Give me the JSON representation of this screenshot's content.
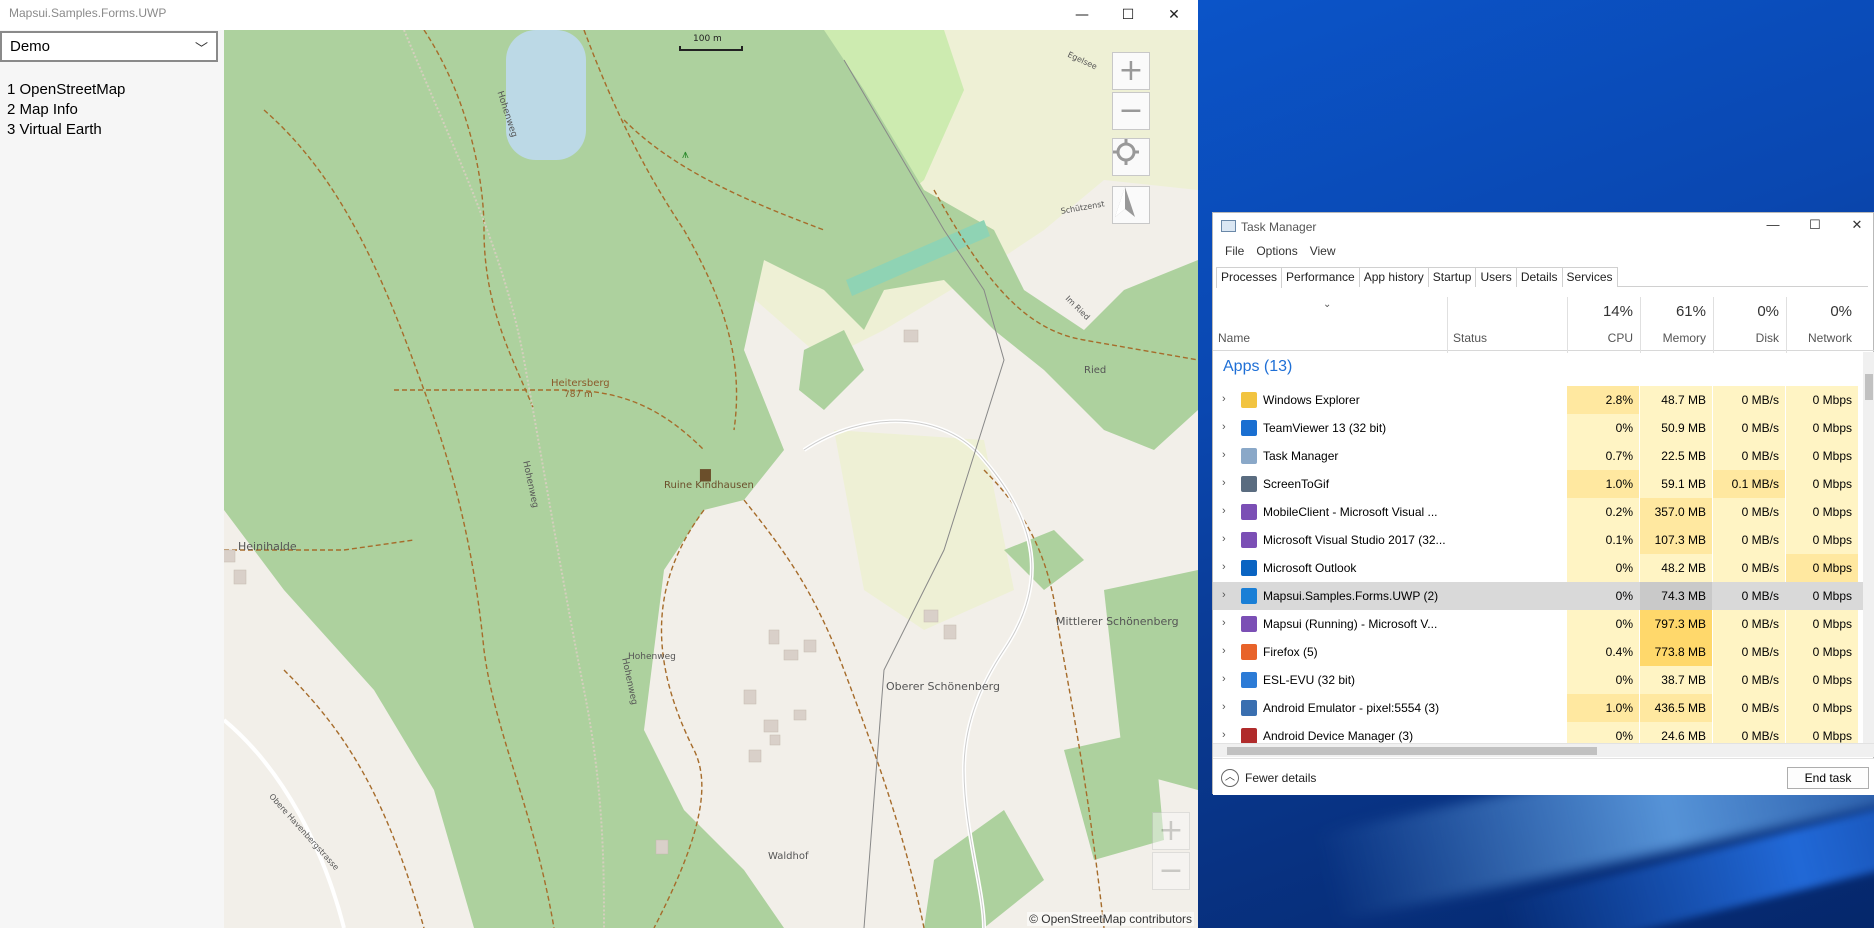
{
  "app": {
    "title": "Mapsui.Samples.Forms.UWP",
    "minimize": "—",
    "maximize": "☐",
    "close": "✕"
  },
  "sidebar": {
    "category": "Demo",
    "samples": [
      "1 OpenStreetMap",
      "2 Map Info",
      "3 Virtual Earth"
    ]
  },
  "map": {
    "scale_label": "100 m",
    "attribution": "© OpenStreetMap contributors",
    "labels": {
      "heitersberg": "Heitersberg",
      "heitersberg_elev": "787 m",
      "ruine": "Ruine Kindhausen",
      "heinihalde": "Heinihalde",
      "hohenweg1": "Hohenweg",
      "hohenweg2": "Hohenweg",
      "hohenweg3": "Hohenweg",
      "hohenweg4": "Hohenweg",
      "mittlerer": "Mittlerer Schönenberg",
      "oberer": "Oberer Schönenberg",
      "waldhof": "Waldhof",
      "ried": "Ried",
      "im_ried": "Im Ried",
      "schuetzenst": "Schützenst",
      "egelsee": "Egelsee",
      "obere_haven": "Obere Havenbergstrasse"
    },
    "controls": {
      "zoom_in": "+",
      "zoom_out": "−"
    }
  },
  "task_manager": {
    "title": "Task Manager",
    "menu": [
      "File",
      "Options",
      "View"
    ],
    "tabs": [
      "Processes",
      "Performance",
      "App history",
      "Startup",
      "Users",
      "Details",
      "Services"
    ],
    "columns": {
      "name": "Name",
      "status": "Status",
      "cpu_pct": "14%",
      "cpu": "CPU",
      "mem_pct": "61%",
      "mem": "Memory",
      "disk_pct": "0%",
      "disk": "Disk",
      "net_pct": "0%",
      "net": "Network"
    },
    "group": "Apps (13)",
    "rows": [
      {
        "name": "Windows Explorer",
        "cpu": "2.8%",
        "mem": "48.7 MB",
        "disk": "0 MB/s",
        "net": "0 Mbps",
        "icon_color": "#f2c440"
      },
      {
        "name": "TeamViewer 13 (32 bit)",
        "cpu": "0%",
        "mem": "50.9 MB",
        "disk": "0 MB/s",
        "net": "0 Mbps",
        "icon_color": "#1a6fd1"
      },
      {
        "name": "Task Manager",
        "cpu": "0.7%",
        "mem": "22.5 MB",
        "disk": "0 MB/s",
        "net": "0 Mbps",
        "icon_color": "#8aa8c8"
      },
      {
        "name": "ScreenToGif",
        "cpu": "1.0%",
        "mem": "59.1 MB",
        "disk": "0.1 MB/s",
        "net": "0 Mbps",
        "icon_color": "#5a6c80"
      },
      {
        "name": "MobileClient - Microsoft Visual ...",
        "cpu": "0.2%",
        "mem": "357.0 MB",
        "disk": "0 MB/s",
        "net": "0 Mbps",
        "icon_color": "#7b4fb5"
      },
      {
        "name": "Microsoft Visual Studio 2017 (32...",
        "cpu": "0.1%",
        "mem": "107.3 MB",
        "disk": "0 MB/s",
        "net": "0 Mbps",
        "icon_color": "#7b4fb5"
      },
      {
        "name": "Microsoft Outlook",
        "cpu": "0%",
        "mem": "48.2 MB",
        "disk": "0 MB/s",
        "net": "0 Mbps",
        "icon_color": "#0a64c2"
      },
      {
        "name": "Mapsui.Samples.Forms.UWP (2)",
        "cpu": "0%",
        "mem": "74.3 MB",
        "disk": "0 MB/s",
        "net": "0 Mbps",
        "icon_color": "#1a7fd6"
      },
      {
        "name": "Mapsui (Running) - Microsoft V...",
        "cpu": "0%",
        "mem": "797.3 MB",
        "disk": "0 MB/s",
        "net": "0 Mbps",
        "icon_color": "#7b4fb5"
      },
      {
        "name": "Firefox (5)",
        "cpu": "0.4%",
        "mem": "773.8 MB",
        "disk": "0 MB/s",
        "net": "0 Mbps",
        "icon_color": "#e8632a"
      },
      {
        "name": "ESL-EVU (32 bit)",
        "cpu": "0%",
        "mem": "38.7 MB",
        "disk": "0 MB/s",
        "net": "0 Mbps",
        "icon_color": "#2c7bd6"
      },
      {
        "name": "Android Emulator - pixel:5554 (3)",
        "cpu": "1.0%",
        "mem": "436.5 MB",
        "disk": "0 MB/s",
        "net": "0 Mbps",
        "icon_color": "#3a6fb0"
      },
      {
        "name": "Android Device Manager (3)",
        "cpu": "0%",
        "mem": "24.6 MB",
        "disk": "0 MB/s",
        "net": "0 Mbps",
        "icon_color": "#b02b2b"
      }
    ],
    "fewer_details": "Fewer details",
    "end_task": "End task"
  },
  "colors": {
    "forest": "#add19e",
    "farmland": "#eef0d5",
    "grass": "#cdebb0",
    "accent_blue": "#1e6fd6",
    "heat_low": "#fff4c4",
    "heat_mid": "#ffe8a0",
    "heat_high": "#ffd86b"
  }
}
